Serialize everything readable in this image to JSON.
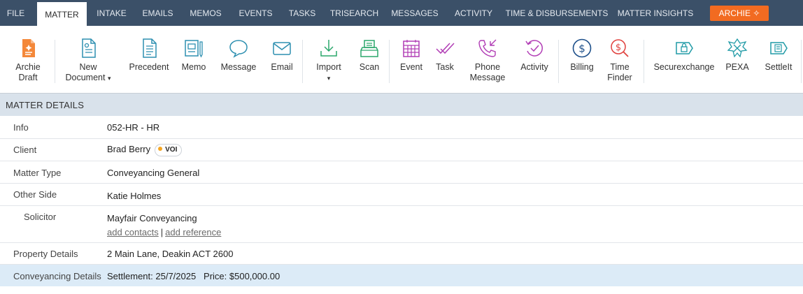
{
  "nav": {
    "tabs": [
      "FILE",
      "MATTER",
      "INTAKE",
      "EMAILS",
      "MEMOS",
      "EVENTS",
      "TASKS",
      "TRISEARCH",
      "MESSAGES",
      "ACTIVITY",
      "TIME & DISBURSEMENTS",
      "MATTER INSIGHTS"
    ],
    "active_tab": "MATTER",
    "archie_label": "ARCHIE",
    "archie_color": "#f26b21"
  },
  "ribbon": {
    "archie_draft": "Archie\nDraft",
    "new_document": "New\nDocument",
    "precedent": "Precedent",
    "memo": "Memo",
    "message": "Message",
    "email": "Email",
    "import": "Import",
    "scan": "Scan",
    "event": "Event",
    "task": "Task",
    "phone_message": "Phone\nMessage",
    "activity": "Activity",
    "billing": "Billing",
    "time_finder": "Time\nFinder",
    "securexchange": "Securexchange",
    "pexa": "PEXA",
    "settleit": "SettleIt"
  },
  "matter_details": {
    "heading": "MATTER DETAILS",
    "info_label": "Info",
    "info_value": "052-HR - HR",
    "client_label": "Client",
    "client_value": "Brad Berry",
    "client_badge": "VOI",
    "matter_type_label": "Matter Type",
    "matter_type_value": "Conveyancing General",
    "other_side_label": "Other Side",
    "other_side_value": "Katie Holmes",
    "solicitor_label": "Solicitor",
    "solicitor_value": "Mayfair Conveyancing",
    "add_contacts": "add contacts",
    "add_reference": "add reference",
    "property_label": "Property Details",
    "property_value": "2 Main Lane, Deakin ACT 2600",
    "conveyancing_label": "Conveyancing Details",
    "conveyancing_value": "Settlement: 25/7/2025   Price: $500,000.00"
  }
}
